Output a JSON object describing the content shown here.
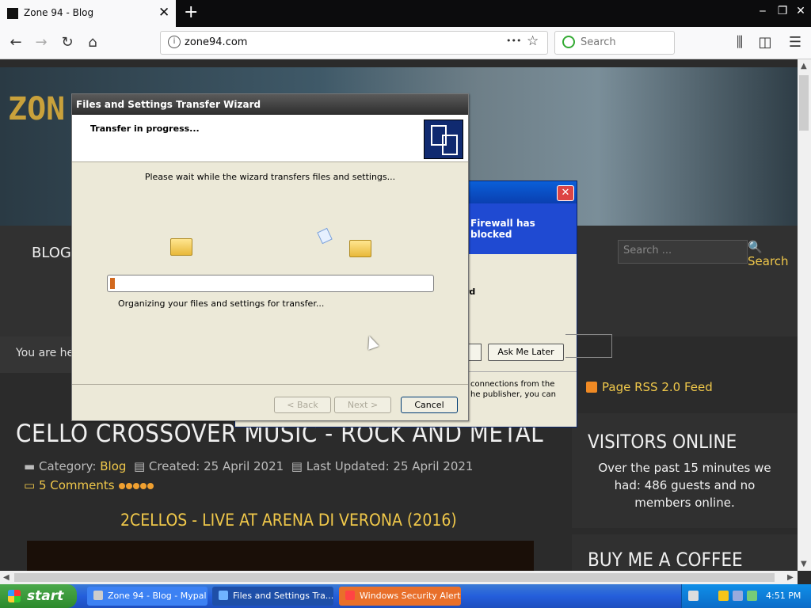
{
  "browser": {
    "tab_title": "Zone 94 - Blog",
    "url": "zone94.com",
    "search_placeholder": "Search",
    "more_icon": "•••",
    "star_icon": "☆"
  },
  "page": {
    "logo": "ZON",
    "menu_blog": "BLOG",
    "search_placeholder": "Search ...",
    "search_button": "Search",
    "breadcrumb": "You are he",
    "rss": "Page RSS 2.0 Feed",
    "article_title": "CELLO CROSSOVER MUSIC - ROCK AND METAL",
    "meta_category_label": "Category:",
    "meta_category": "Blog",
    "meta_created": "Created: 25 April 2021",
    "meta_updated": "Last Updated: 25 April 2021",
    "comments": "5 Comments",
    "video_title": "2CELLOS - LIVE AT ARENA DI VERONA (2016)",
    "visitors_heading": "VISITORS ONLINE",
    "visitors_text": "Over the past 15 minutes we had: 486 guests and no members online.",
    "coffee_heading": "BUY ME A COFFEE"
  },
  "security_alert": {
    "banner_text": "Firewall has blocked",
    "partial_text": "rd",
    "ask_later_button": "Ask Me Later",
    "info_line1": "connections from the",
    "info_line2": "he publisher, you can"
  },
  "wizard": {
    "title": "Files and Settings Transfer Wizard",
    "header": "Transfer in progress...",
    "message": "Please wait while the wizard transfers files and settings...",
    "status": "Organizing your files and settings for transfer...",
    "progress": 0.015,
    "back_button": "< Back",
    "next_button": "Next >",
    "cancel_button": "Cancel"
  },
  "taskbar": {
    "start": "start",
    "tasks": [
      {
        "label": "Zone 94 - Blog - Mypal"
      },
      {
        "label": "Files and Settings Tra..."
      },
      {
        "label": "Windows Security Alert"
      }
    ],
    "clock": "4:51 PM"
  }
}
